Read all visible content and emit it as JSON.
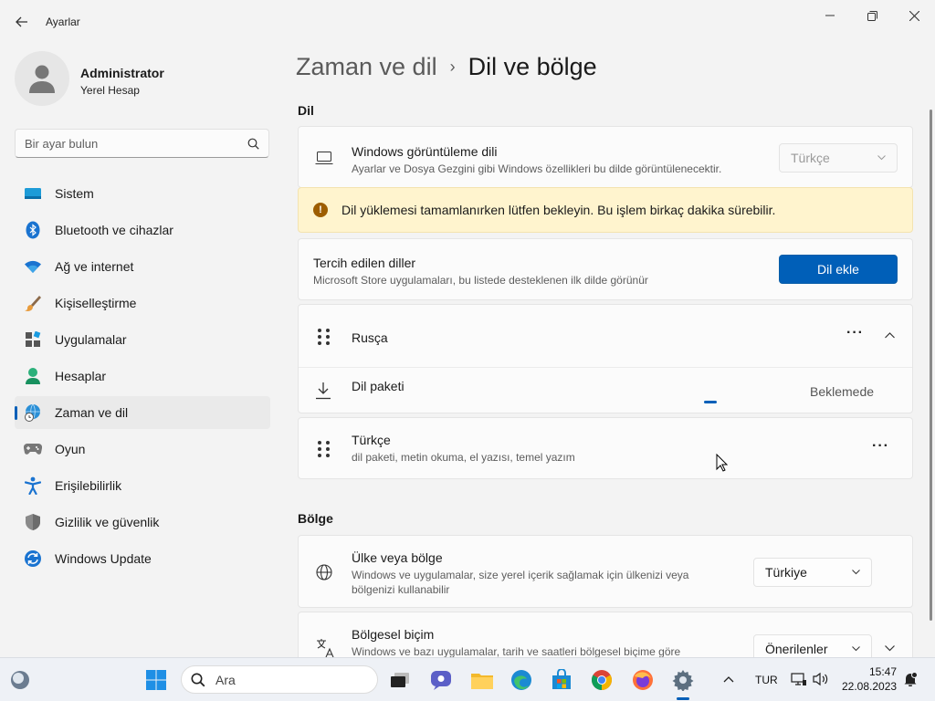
{
  "window": {
    "app_title": "Ayarlar"
  },
  "profile": {
    "name": "Administrator",
    "account_type": "Yerel Hesap"
  },
  "search": {
    "placeholder": "Bir ayar bulun"
  },
  "sidebar": {
    "items": [
      {
        "label": "Sistem",
        "icon": "system-icon"
      },
      {
        "label": "Bluetooth ve cihazlar",
        "icon": "bluetooth-icon"
      },
      {
        "label": "Ağ ve internet",
        "icon": "wifi-icon"
      },
      {
        "label": "Kişiselleştirme",
        "icon": "brush-icon"
      },
      {
        "label": "Uygulamalar",
        "icon": "apps-icon"
      },
      {
        "label": "Hesaplar",
        "icon": "person-icon"
      },
      {
        "label": "Zaman ve dil",
        "icon": "globe-clock-icon",
        "active": true
      },
      {
        "label": "Oyun",
        "icon": "gamepad-icon"
      },
      {
        "label": "Erişilebilirlik",
        "icon": "accessibility-icon"
      },
      {
        "label": "Gizlilik ve güvenlik",
        "icon": "shield-icon"
      },
      {
        "label": "Windows Update",
        "icon": "update-icon"
      }
    ]
  },
  "breadcrumb": {
    "parent": "Zaman ve dil",
    "separator": "›",
    "current": "Dil ve bölge"
  },
  "language_section": {
    "heading": "Dil",
    "display_language": {
      "title": "Windows görüntüleme dili",
      "subtitle": "Ayarlar ve Dosya Gezgini gibi Windows özellikleri bu dilde görüntülenecektir.",
      "value": "Türkçe"
    },
    "warning": "Dil yüklemesi tamamlanırken lütfen bekleyin. Bu işlem birkaç dakika sürebilir.",
    "preferred": {
      "title": "Tercih edilen diller",
      "subtitle": "Microsoft Store uygulamaları, bu listede desteklenen ilk dilde görünür",
      "add_button": "Dil ekle"
    },
    "languages": [
      {
        "name": "Rusça",
        "package_label": "Dil paketi",
        "package_status": "Beklemede"
      },
      {
        "name": "Türkçe",
        "features": "dil paketi, metin okuma, el yazısı, temel yazım"
      }
    ]
  },
  "region_section": {
    "heading": "Bölge",
    "country": {
      "title": "Ülke veya bölge",
      "subtitle": "Windows ve uygulamalar, size yerel içerik sağlamak için ülkenizi veya bölgenizi kullanabilir",
      "value": "Türkiye"
    },
    "format": {
      "title": "Bölgesel biçim",
      "subtitle": "Windows ve bazı uygulamalar, tarih ve saatleri bölgesel biçime göre",
      "value": "Önerilenler"
    }
  },
  "taskbar": {
    "search_placeholder": "Ara",
    "language": "TUR",
    "time": "15:47",
    "date": "22.08.2023"
  },
  "colors": {
    "accent": "#005fb8",
    "warning_bg": "#fff4ce",
    "warning_icon": "#9d5d00"
  }
}
